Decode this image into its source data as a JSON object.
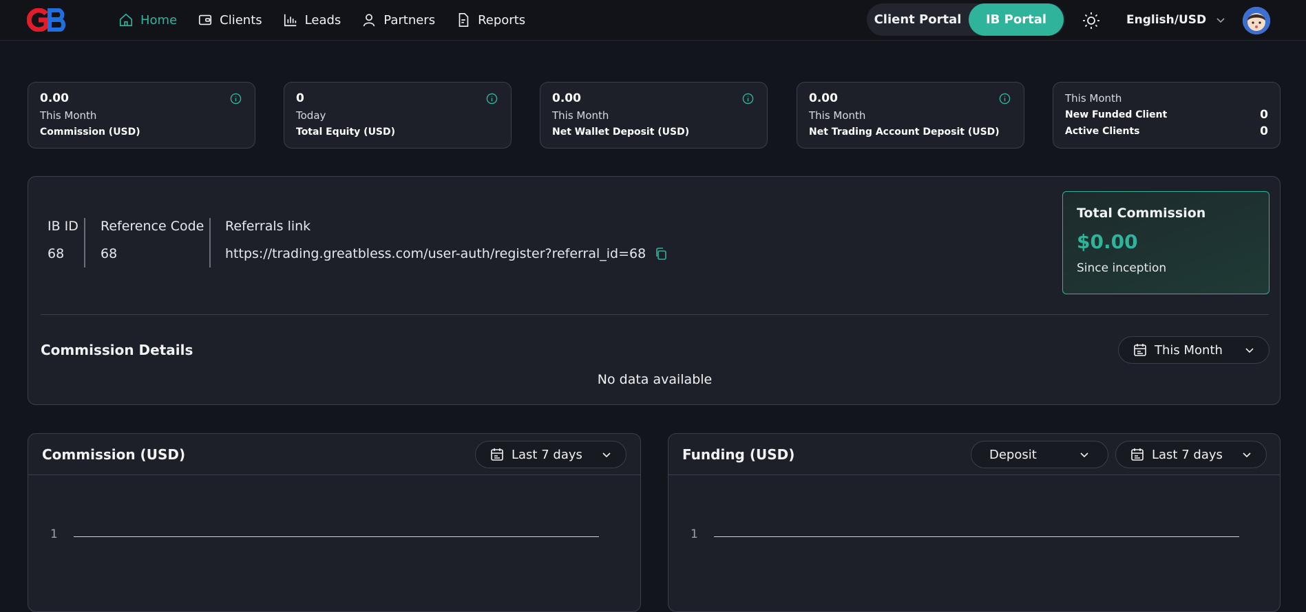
{
  "nav": {
    "items": [
      {
        "label": "Home",
        "icon": "home-icon",
        "active": true
      },
      {
        "label": "Clients",
        "icon": "wallet-icon"
      },
      {
        "label": "Leads",
        "icon": "bar-chart-icon"
      },
      {
        "label": "Partners",
        "icon": "user-icon"
      },
      {
        "label": "Reports",
        "icon": "document-icon"
      }
    ],
    "client_portal": "Client Portal",
    "ib_portal": "IB Portal",
    "language": "English/USD"
  },
  "stats": [
    {
      "value": "0.00",
      "period": "This Month",
      "label": "Commission (USD)"
    },
    {
      "value": "0",
      "period": "Today",
      "label": "Total Equity (USD)"
    },
    {
      "value": "0.00",
      "period": "This Month",
      "label": "Net Wallet Deposit (USD)"
    },
    {
      "value": "0.00",
      "period": "This Month",
      "label": "Net Trading Account Deposit (USD)"
    }
  ],
  "clients_card": {
    "period": "This Month",
    "new_funded_label": "New Funded Client",
    "new_funded_value": "0",
    "active_label": "Active Clients",
    "active_value": "0"
  },
  "ib": {
    "id_label": "IB ID",
    "id_value": "68",
    "ref_label": "Reference Code",
    "ref_value": "68",
    "link_label": "Referrals link",
    "link_value": "https://trading.greatbless.com/user-auth/register?referral_id=68",
    "total_title": "Total Commission",
    "total_amount": "$0.00",
    "total_since": "Since inception",
    "details_title": "Commission Details",
    "details_period": "This Month",
    "no_data": "No data available"
  },
  "charts": {
    "commission": {
      "title": "Commission (USD)",
      "period": "Last 7 days",
      "tick": "1"
    },
    "funding": {
      "title": "Funding (USD)",
      "type": "Deposit",
      "period": "Last 7 days",
      "tick": "1"
    }
  },
  "colors": {
    "accent": "#2fb39a",
    "background": "#13151c",
    "card": "#1d2028"
  }
}
